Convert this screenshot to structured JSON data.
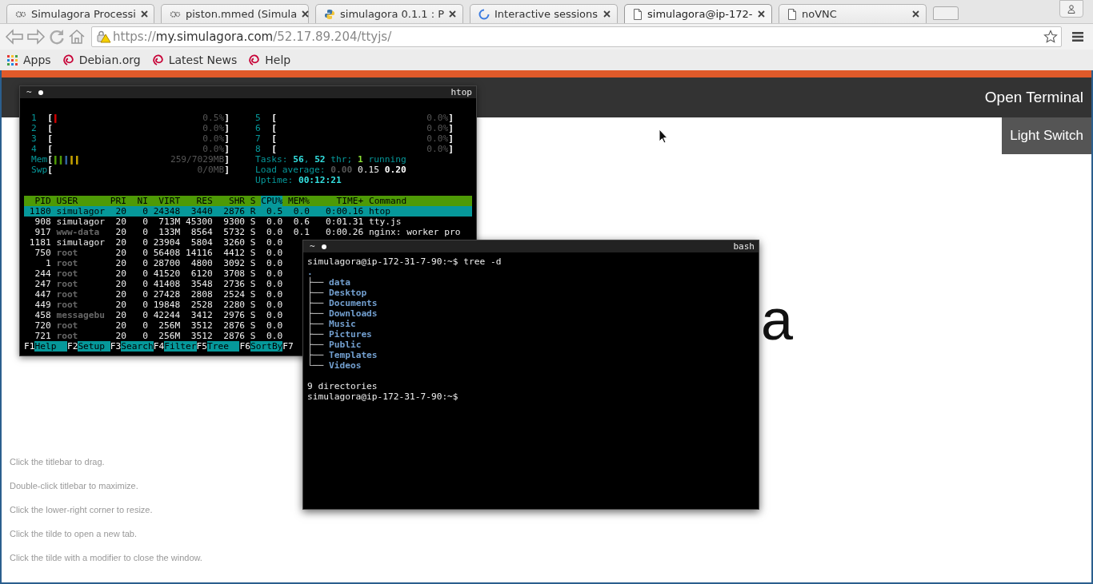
{
  "browser": {
    "tabs": [
      {
        "title": "Simulagora Processi",
        "selected": false
      },
      {
        "title": "piston.mmed (Simula",
        "selected": false
      },
      {
        "title": "simulagora 0.1.1 : P",
        "selected": false
      },
      {
        "title": "Interactive sessions",
        "selected": false
      },
      {
        "title": "simulagora@ip-172-",
        "selected": true
      },
      {
        "title": "noVNC",
        "selected": false
      }
    ],
    "url": {
      "scheme": "https://",
      "host": "my.simulagora.com",
      "path": "/52.17.89.204/ttyjs/"
    },
    "bookmarks": [
      {
        "label": "Apps"
      },
      {
        "label": "Debian.org"
      },
      {
        "label": "Latest News"
      },
      {
        "label": "Help"
      }
    ]
  },
  "page": {
    "header_link": "Open Terminal",
    "light_switch": "Light Switch",
    "heading": "a",
    "hints": [
      "Click the titlebar to drag.",
      "Double-click titlebar to maximize.",
      "Click the lower-right corner to resize.",
      "Click the tilde to open a new tab.",
      "Click the tilde with a modifier to close the window."
    ]
  },
  "htop": {
    "tilde": "~",
    "title": "htop",
    "meters_left": [
      {
        "label": "1",
        "open": "[",
        "bar": [
          {
            "text": "|",
            "color": "#cc0000"
          }
        ],
        "value": "0.5%",
        "close": "]"
      },
      {
        "label": "2",
        "open": "[",
        "value": "0.0%",
        "close": "]"
      },
      {
        "label": "3",
        "open": "[",
        "value": "0.0%",
        "close": "]"
      },
      {
        "label": "4",
        "open": "[",
        "value": "0.0%",
        "close": "]"
      },
      {
        "label": "Mem",
        "open": "[",
        "bar": [
          {
            "text": "||",
            "color": "#4e9a06"
          },
          {
            "text": "|",
            "color": "#3465a4"
          },
          {
            "text": "||",
            "color": "#c4a000"
          }
        ],
        "value": "259/7029MB",
        "close": "]"
      },
      {
        "label": "Swp",
        "open": "[",
        "value": "0/0MB",
        "close": "]"
      }
    ],
    "meters_right": [
      {
        "label": "5",
        "open": "[",
        "value": "0.0%",
        "close": "]"
      },
      {
        "label": "6",
        "open": "[",
        "value": "0.0%",
        "close": "]"
      },
      {
        "label": "7",
        "open": "[",
        "value": "0.0%",
        "close": "]"
      },
      {
        "label": "8",
        "open": "[",
        "value": "0.0%",
        "close": "]"
      }
    ],
    "info": [
      [
        {
          "text": "Tasks: ",
          "kind": "label"
        },
        {
          "text": "56",
          "kind": "value"
        },
        {
          "text": ", ",
          "kind": "label"
        },
        {
          "text": "52",
          "kind": "value"
        },
        {
          "text": " thr; ",
          "kind": "label"
        },
        {
          "text": "1",
          "kind": "running"
        },
        {
          "text": " running",
          "kind": "label"
        }
      ],
      [
        {
          "text": "Load average: ",
          "kind": "label"
        },
        {
          "text": "0.00",
          "kind": "dim"
        },
        {
          "text": " 0.15 ",
          "kind": "plain"
        },
        {
          "text": "0.20",
          "kind": "strong"
        }
      ],
      [
        {
          "text": "Uptime: ",
          "kind": "label"
        },
        {
          "text": "00:12:21",
          "kind": "value"
        }
      ]
    ],
    "columns": [
      {
        "label": "PID",
        "sorted": false
      },
      {
        "label": "USER",
        "sorted": false
      },
      {
        "label": "PRI",
        "sorted": false
      },
      {
        "label": "NI",
        "sorted": false
      },
      {
        "label": "VIRT",
        "sorted": false
      },
      {
        "label": "RES",
        "sorted": false
      },
      {
        "label": "SHR",
        "sorted": false
      },
      {
        "label": "S",
        "sorted": false
      },
      {
        "label": "CPU%",
        "sorted": true
      },
      {
        "label": "MEM%",
        "sorted": false
      },
      {
        "label": "TIME+",
        "sorted": false
      },
      {
        "label": "Command",
        "sorted": false
      }
    ],
    "rows": [
      {
        "selected": true,
        "user_dimmed": false,
        "cells": [
          "1180",
          "simulagor",
          "20",
          "0",
          "24348",
          "3440",
          "2876",
          "R",
          "0.5",
          "0.0",
          "0:00.16",
          "htop"
        ]
      },
      {
        "selected": false,
        "user_dimmed": false,
        "cells": [
          "908",
          "simulagor",
          "20",
          "0",
          "713M",
          "45300",
          "9300",
          "S",
          "0.0",
          "0.6",
          "0:01.31",
          "tty.js"
        ]
      },
      {
        "selected": false,
        "user_dimmed": true,
        "cells": [
          "917",
          "www-data",
          "20",
          "0",
          "133M",
          "8564",
          "5732",
          "S",
          "0.0",
          "0.1",
          "0:00.26",
          "nginx: worker pro"
        ]
      },
      {
        "selected": false,
        "user_dimmed": false,
        "cells": [
          "1181",
          "simulagor",
          "20",
          "0",
          "23904",
          "5804",
          "3260",
          "S",
          "0.0"
        ]
      },
      {
        "selected": false,
        "user_dimmed": true,
        "cells": [
          "750",
          "root",
          "20",
          "0",
          "56408",
          "14116",
          "4412",
          "S",
          "0.0"
        ]
      },
      {
        "selected": false,
        "user_dimmed": true,
        "cells": [
          "1",
          "root",
          "20",
          "0",
          "28700",
          "4800",
          "3092",
          "S",
          "0.0"
        ]
      },
      {
        "selected": false,
        "user_dimmed": true,
        "cells": [
          "244",
          "root",
          "20",
          "0",
          "41520",
          "6120",
          "3708",
          "S",
          "0.0"
        ]
      },
      {
        "selected": false,
        "user_dimmed": true,
        "cells": [
          "247",
          "root",
          "20",
          "0",
          "41408",
          "3548",
          "2736",
          "S",
          "0.0"
        ]
      },
      {
        "selected": false,
        "user_dimmed": true,
        "cells": [
          "447",
          "root",
          "20",
          "0",
          "27428",
          "2808",
          "2524",
          "S",
          "0.0"
        ]
      },
      {
        "selected": false,
        "user_dimmed": true,
        "cells": [
          "449",
          "root",
          "20",
          "0",
          "19848",
          "2528",
          "2280",
          "S",
          "0.0"
        ]
      },
      {
        "selected": false,
        "user_dimmed": true,
        "cells": [
          "458",
          "messagebu",
          "20",
          "0",
          "42244",
          "3412",
          "2976",
          "S",
          "0.0"
        ]
      },
      {
        "selected": false,
        "user_dimmed": true,
        "cells": [
          "720",
          "root",
          "20",
          "0",
          "256M",
          "3512",
          "2876",
          "S",
          "0.0"
        ]
      },
      {
        "selected": false,
        "user_dimmed": true,
        "cells": [
          "721",
          "root",
          "20",
          "0",
          "256M",
          "3512",
          "2876",
          "S",
          "0.0"
        ]
      }
    ],
    "footer": [
      {
        "key": "F1",
        "label": "Help"
      },
      {
        "key": "F2",
        "label": "Setup"
      },
      {
        "key": "F3",
        "label": "Search"
      },
      {
        "key": "F4",
        "label": "Filter"
      },
      {
        "key": "F5",
        "label": "Tree"
      },
      {
        "key": "F6",
        "label": "SortBy"
      },
      {
        "key": "F7"
      }
    ]
  },
  "bash": {
    "tilde": "~",
    "title": "bash",
    "lines": [
      {
        "kind": "text",
        "text": "simulagora@ip-172-31-7-90:~$ tree -d"
      },
      {
        "kind": "dir",
        "text": "."
      },
      {
        "kind": "tree",
        "branch": "├──",
        "name": "data"
      },
      {
        "kind": "tree",
        "branch": "├──",
        "name": "Desktop"
      },
      {
        "kind": "tree",
        "branch": "├──",
        "name": "Documents"
      },
      {
        "kind": "tree",
        "branch": "├──",
        "name": "Downloads"
      },
      {
        "kind": "tree",
        "branch": "├──",
        "name": "Music"
      },
      {
        "kind": "tree",
        "branch": "├──",
        "name": "Pictures"
      },
      {
        "kind": "tree",
        "branch": "├──",
        "name": "Public"
      },
      {
        "kind": "tree",
        "branch": "├──",
        "name": "Templates"
      },
      {
        "kind": "tree",
        "branch": "└──",
        "name": "Videos"
      },
      {
        "kind": "blank"
      },
      {
        "kind": "text",
        "text": "9 directories"
      },
      {
        "kind": "text",
        "text": "simulagora@ip-172-31-7-90:~$"
      }
    ]
  }
}
